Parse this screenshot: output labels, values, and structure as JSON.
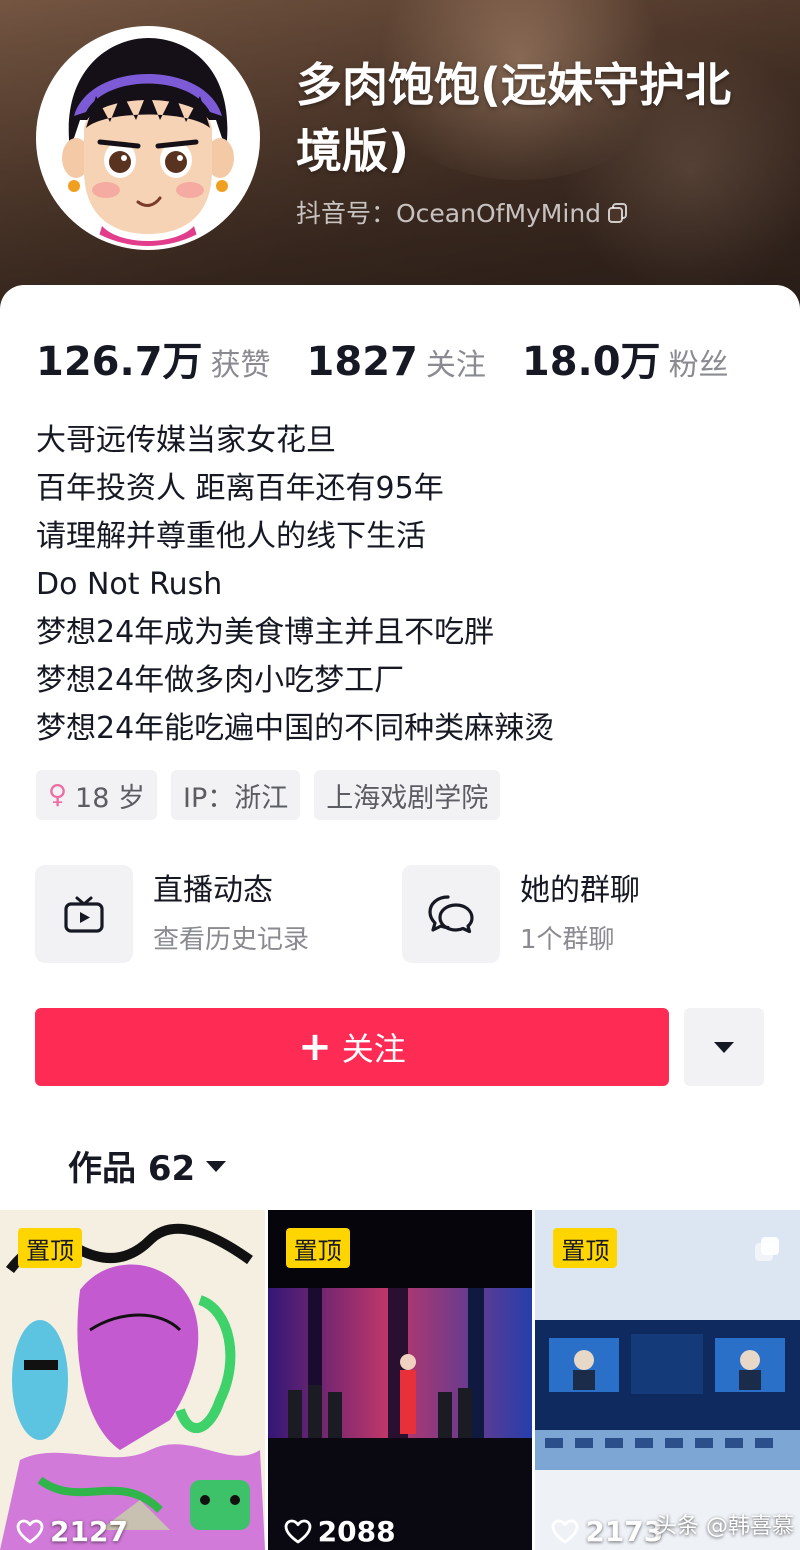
{
  "profile": {
    "name": "多肉饱饱(远妹守护北境版)",
    "douyin_id": "抖音号：OceanOfMyMind"
  },
  "stats": [
    {
      "value": "126.7万",
      "label": "获赞"
    },
    {
      "value": "1827",
      "label": "关注"
    },
    {
      "value": "18.0万",
      "label": "粉丝"
    }
  ],
  "bio": [
    "大哥远传媒当家女花旦",
    "百年投资人 距离百年还有95年",
    "请理解并尊重他人的线下生活",
    "Do Not Rush",
    "梦想24年成为美食博主并且不吃胖",
    "梦想24年做多肉小吃梦工厂",
    "梦想24年能吃遍中国的不同种类麻辣烫"
  ],
  "tags": {
    "age": "18 岁",
    "ip": "IP：浙江",
    "school": "上海戏剧学院"
  },
  "features": {
    "live": {
      "title": "直播动态",
      "sub": "查看历史记录",
      "icon": "tv-icon"
    },
    "group": {
      "title": "她的群聊",
      "sub": "1个群聊",
      "icon": "chat-bubbles-icon"
    }
  },
  "actions": {
    "follow_label": "关注",
    "more_icon": "caret-down-icon"
  },
  "works": {
    "label": "作品 62"
  },
  "videos": [
    {
      "pin": "置顶",
      "likes": "2127"
    },
    {
      "pin": "置顶",
      "likes": "2088"
    },
    {
      "pin": "置顶",
      "likes": "2173"
    }
  ],
  "watermark": "头条 @韩喜慕",
  "colors": {
    "accent": "#fe2c55",
    "pin_badge": "#ffd500",
    "muted": "#8a8b91"
  }
}
